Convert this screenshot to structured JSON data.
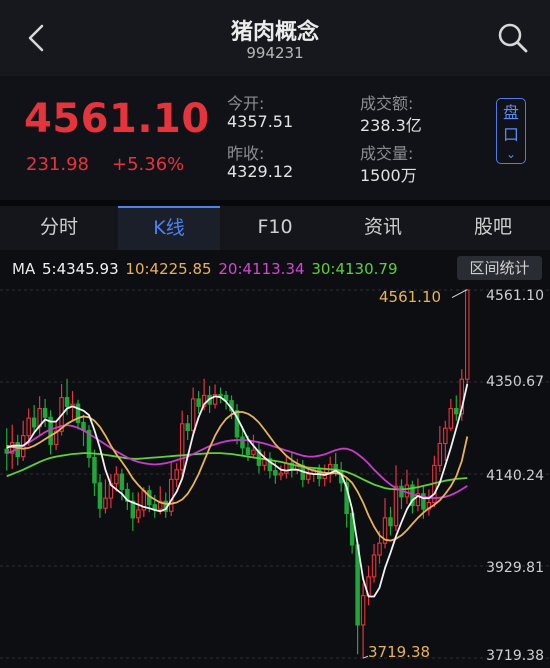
{
  "header": {
    "title": "猪肉概念",
    "code": "994231"
  },
  "quote": {
    "price": "4561.10",
    "change": "231.98",
    "change_pct": "+5.36%",
    "open_label": "今开:",
    "open_value": "4357.51",
    "prev_close_label": "昨收:",
    "prev_close_value": "4329.12",
    "turnover_label": "成交额:",
    "turnover_value": "238.3亿",
    "volume_label": "成交量:",
    "volume_value": "1500万",
    "plate_button": "盘口"
  },
  "tabs": [
    "分时",
    "K线",
    "F10",
    "资讯",
    "股吧"
  ],
  "active_tab": 1,
  "chart_header": {
    "ma_label": "MA",
    "ma5": "5:4345.93",
    "ma10": "10:4225.85",
    "ma20": "20:4113.34",
    "ma30": "30:4130.79",
    "range_button": "区间统计"
  },
  "colors": {
    "up": "#e5343b",
    "down": "#1fa83a",
    "ma5": "#f2f2f2",
    "ma10": "#e8b25a",
    "ma20": "#c93cc9",
    "ma30": "#5fcf3a",
    "accent": "#4e82f1"
  },
  "chart_data": {
    "type": "candlestick",
    "y_ticks": [
      "4561.10",
      "4350.67",
      "4140.24",
      "3929.81",
      "3719.38"
    ],
    "ylim": [
      3719.38,
      4561.1
    ],
    "high_label": "4561.10",
    "low_label": "3719.38",
    "candles": [
      [
        4197,
        4188,
        4245,
        4148
      ],
      [
        4188,
        4212,
        4253,
        4152
      ],
      [
        4212,
        4180,
        4230,
        4160
      ],
      [
        4180,
        4228,
        4262,
        4170
      ],
      [
        4228,
        4268,
        4290,
        4205
      ],
      [
        4268,
        4248,
        4298,
        4235
      ],
      [
        4248,
        4290,
        4318,
        4230
      ],
      [
        4290,
        4270,
        4312,
        4248
      ],
      [
        4270,
        4208,
        4286,
        4185
      ],
      [
        4208,
        4238,
        4258,
        4195
      ],
      [
        4238,
        4315,
        4346,
        4228
      ],
      [
        4315,
        4295,
        4358,
        4275
      ],
      [
        4295,
        4300,
        4330,
        4262
      ],
      [
        4300,
        4258,
        4310,
        4242
      ],
      [
        4258,
        4240,
        4276,
        4204
      ],
      [
        4240,
        4178,
        4252,
        4155
      ],
      [
        4178,
        4120,
        4196,
        4090
      ],
      [
        4120,
        4062,
        4140,
        4040
      ],
      [
        4062,
        4085,
        4128,
        4050
      ],
      [
        4085,
        4118,
        4140,
        4062
      ],
      [
        4118,
        4140,
        4158,
        4100
      ],
      [
        4140,
        4105,
        4152,
        4080
      ],
      [
        4105,
        4078,
        4120,
        4058
      ],
      [
        4078,
        4040,
        4098,
        4010
      ],
      [
        4040,
        4058,
        4098,
        4028
      ],
      [
        4058,
        4102,
        4110,
        4042
      ],
      [
        4102,
        4070,
        4114,
        4053
      ],
      [
        4070,
        4060,
        4092,
        4040
      ],
      [
        4060,
        4078,
        4112,
        4048
      ],
      [
        4078,
        4055,
        4098,
        4040
      ],
      [
        4055,
        4128,
        4168,
        4044
      ],
      [
        4128,
        4150,
        4165,
        4110
      ],
      [
        4150,
        4255,
        4285,
        4134
      ],
      [
        4255,
        4240,
        4275,
        4218
      ],
      [
        4240,
        4312,
        4338,
        4228
      ],
      [
        4312,
        4295,
        4330,
        4278
      ],
      [
        4295,
        4320,
        4358,
        4286
      ],
      [
        4320,
        4300,
        4342,
        4280
      ],
      [
        4300,
        4322,
        4345,
        4290
      ],
      [
        4322,
        4320,
        4338,
        4302
      ],
      [
        4320,
        4308,
        4330,
        4288
      ],
      [
        4308,
        4285,
        4320,
        4266
      ],
      [
        4285,
        4225,
        4300,
        4208
      ],
      [
        4225,
        4200,
        4250,
        4185
      ],
      [
        4200,
        4185,
        4228,
        4170
      ],
      [
        4185,
        4195,
        4230,
        4176
      ],
      [
        4195,
        4160,
        4215,
        4142
      ],
      [
        4160,
        4175,
        4192,
        4148
      ],
      [
        4175,
        4148,
        4190,
        4130
      ],
      [
        4148,
        4138,
        4168,
        4118
      ],
      [
        4138,
        4142,
        4160,
        4126
      ],
      [
        4142,
        4165,
        4182,
        4130
      ],
      [
        4165,
        4150,
        4190,
        4132
      ],
      [
        4150,
        4160,
        4175,
        4140
      ],
      [
        4160,
        4128,
        4172,
        4110
      ],
      [
        4128,
        4140,
        4150,
        4118
      ],
      [
        4140,
        4150,
        4155,
        4122
      ],
      [
        4150,
        4130,
        4162,
        4112
      ],
      [
        4130,
        4140,
        4162,
        4112
      ],
      [
        4140,
        4162,
        4180,
        4120
      ],
      [
        4162,
        4148,
        4188,
        4135
      ],
      [
        4148,
        4120,
        4168,
        4100
      ],
      [
        4120,
        4050,
        4130,
        4018
      ],
      [
        4050,
        3978,
        4060,
        3958
      ],
      [
        3978,
        3795,
        3985,
        3728
      ],
      [
        3795,
        3862,
        3890,
        3719
      ],
      [
        3862,
        3905,
        3930,
        3840
      ],
      [
        3905,
        3955,
        3980,
        3892
      ],
      [
        3955,
        3982,
        4010,
        3935
      ],
      [
        3982,
        4040,
        4085,
        3970
      ],
      [
        4040,
        4022,
        4065,
        4000
      ],
      [
        4022,
        4112,
        4160,
        4010
      ],
      [
        4112,
        4088,
        4128,
        4060
      ],
      [
        4088,
        4115,
        4150,
        4072
      ],
      [
        4115,
        4068,
        4125,
        4050
      ],
      [
        4068,
        4095,
        4130,
        4055
      ],
      [
        4095,
        4060,
        4112,
        4038
      ],
      [
        4060,
        4075,
        4105,
        4045
      ],
      [
        4075,
        4160,
        4182,
        4065
      ],
      [
        4160,
        4210,
        4250,
        4145
      ],
      [
        4210,
        4245,
        4262,
        4170
      ],
      [
        4245,
        4290,
        4312,
        4238
      ],
      [
        4290,
        4278,
        4320,
        4262
      ],
      [
        4278,
        4357,
        4380,
        4262
      ],
      [
        4357,
        4561,
        4562,
        4345
      ]
    ],
    "ma5": [
      4200,
      4205,
      4205,
      4205,
      4215,
      4235,
      4250,
      4265,
      4260,
      4260,
      4275,
      4290,
      4295,
      4290,
      4285,
      4275,
      4240,
      4200,
      4150,
      4115,
      4105,
      4095,
      4080,
      4075,
      4070,
      4065,
      4062,
      4058,
      4055,
      4060,
      4080,
      4100,
      4130,
      4180,
      4230,
      4270,
      4300,
      4312,
      4318,
      4316,
      4306,
      4290,
      4270,
      4245,
      4220,
      4205,
      4190,
      4178,
      4168,
      4160,
      4150,
      4148,
      4150,
      4150,
      4146,
      4142,
      4140,
      4140,
      4138,
      4142,
      4148,
      4140,
      4110,
      4060,
      3980,
      3900,
      3860,
      3860,
      3880,
      3925,
      3960,
      3998,
      4030,
      4060,
      4080,
      4090,
      4085,
      4085,
      4095,
      4120,
      4160,
      4200,
      4245,
      4290,
      4346
    ],
    "ma10": [
      4205,
      4202,
      4200,
      4198,
      4200,
      4205,
      4212,
      4220,
      4228,
      4235,
      4245,
      4255,
      4262,
      4268,
      4272,
      4270,
      4262,
      4248,
      4228,
      4205,
      4185,
      4168,
      4150,
      4130,
      4115,
      4102,
      4090,
      4082,
      4075,
      4072,
      4072,
      4075,
      4082,
      4095,
      4115,
      4140,
      4170,
      4200,
      4228,
      4250,
      4266,
      4276,
      4282,
      4282,
      4278,
      4270,
      4258,
      4242,
      4225,
      4208,
      4195,
      4182,
      4172,
      4164,
      4158,
      4152,
      4148,
      4145,
      4143,
      4142,
      4142,
      4140,
      4132,
      4120,
      4100,
      4075,
      4045,
      4020,
      4000,
      3990,
      3988,
      3992,
      4000,
      4012,
      4026,
      4040,
      4052,
      4062,
      4070,
      4080,
      4095,
      4112,
      4135,
      4170,
      4226
    ],
    "ma20": [
      4188,
      4192,
      4198,
      4205,
      4212,
      4220,
      4228,
      4236,
      4242,
      4246,
      4250,
      4252,
      4250,
      4246,
      4240,
      4232,
      4224,
      4216,
      4208,
      4200,
      4192,
      4185,
      4178,
      4172,
      4168,
      4165,
      4163,
      4162,
      4163,
      4165,
      4168,
      4172,
      4176,
      4180,
      4186,
      4192,
      4198,
      4204,
      4208,
      4212,
      4215,
      4217,
      4218,
      4218,
      4217,
      4215,
      4213,
      4210,
      4206,
      4202,
      4198,
      4194,
      4190,
      4186,
      4182,
      4180,
      4180,
      4182,
      4185,
      4190,
      4195,
      4198,
      4198,
      4194,
      4186,
      4176,
      4164,
      4150,
      4138,
      4126,
      4116,
      4108,
      4102,
      4098,
      4094,
      4090,
      4088,
      4086,
      4085,
      4086,
      4088,
      4092,
      4098,
      4105,
      4113
    ],
    "ma30": [
      4135,
      4140,
      4145,
      4150,
      4156,
      4162,
      4168,
      4173,
      4177,
      4180,
      4182,
      4184,
      4186,
      4187,
      4188,
      4188,
      4187,
      4186,
      4184,
      4182,
      4180,
      4178,
      4176,
      4175,
      4175,
      4176,
      4177,
      4178,
      4179,
      4180,
      4181,
      4182,
      4183,
      4184,
      4185,
      4186,
      4187,
      4188,
      4188,
      4188,
      4187,
      4186,
      4184,
      4182,
      4180,
      4178,
      4176,
      4174,
      4172,
      4170,
      4168,
      4165,
      4162,
      4159,
      4157,
      4155,
      4154,
      4153,
      4152,
      4151,
      4150,
      4148,
      4145,
      4140,
      4134,
      4128,
      4122,
      4116,
      4112,
      4108,
      4106,
      4105,
      4105,
      4106,
      4108,
      4110,
      4113,
      4116,
      4119,
      4122,
      4125,
      4127,
      4129,
      4130,
      4131
    ]
  }
}
